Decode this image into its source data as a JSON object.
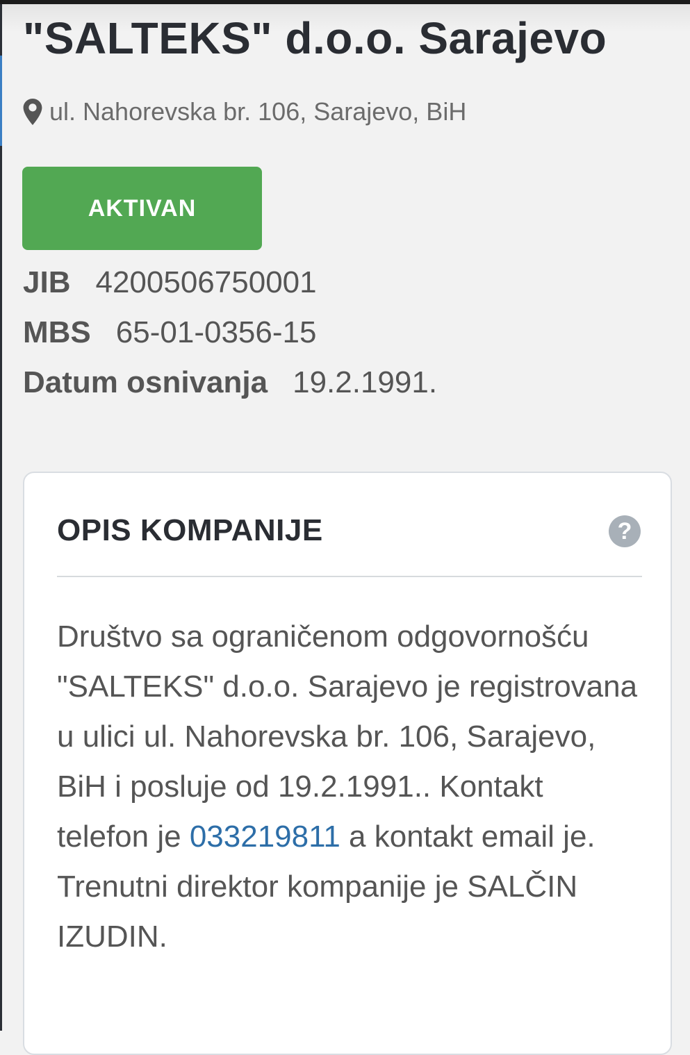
{
  "company": {
    "name": "\"SALTEKS\" d.o.o. Sarajevo",
    "address": "ul. Nahorevska br. 106, Sarajevo, BiH",
    "status": "AKTIVAN",
    "status_color": "#52a853"
  },
  "details": {
    "jib_label": "JIB",
    "jib_value": "4200506750001",
    "mbs_label": "MBS",
    "mbs_value": "65-01-0356-15",
    "founded_label": "Datum osnivanja",
    "founded_value": "19.2.1991."
  },
  "description": {
    "title": "OPIS KOMPANIJE",
    "help_icon": "question-circle-icon",
    "text_part1": "Društvo sa ograničenom odgovornošću \"SALTEKS\" d.o.o. Sarajevo je registrovana u ulici ul. Nahorevska br. 106, Sarajevo, BiH i posluje od 19.2.1991.. Kontakt telefon je ",
    "phone": "033219811",
    "text_part2": " a kontakt email je. Trenutni direktor kompanije je SALČIN IZUDIN.",
    "link_color": "#2d6ea8"
  }
}
